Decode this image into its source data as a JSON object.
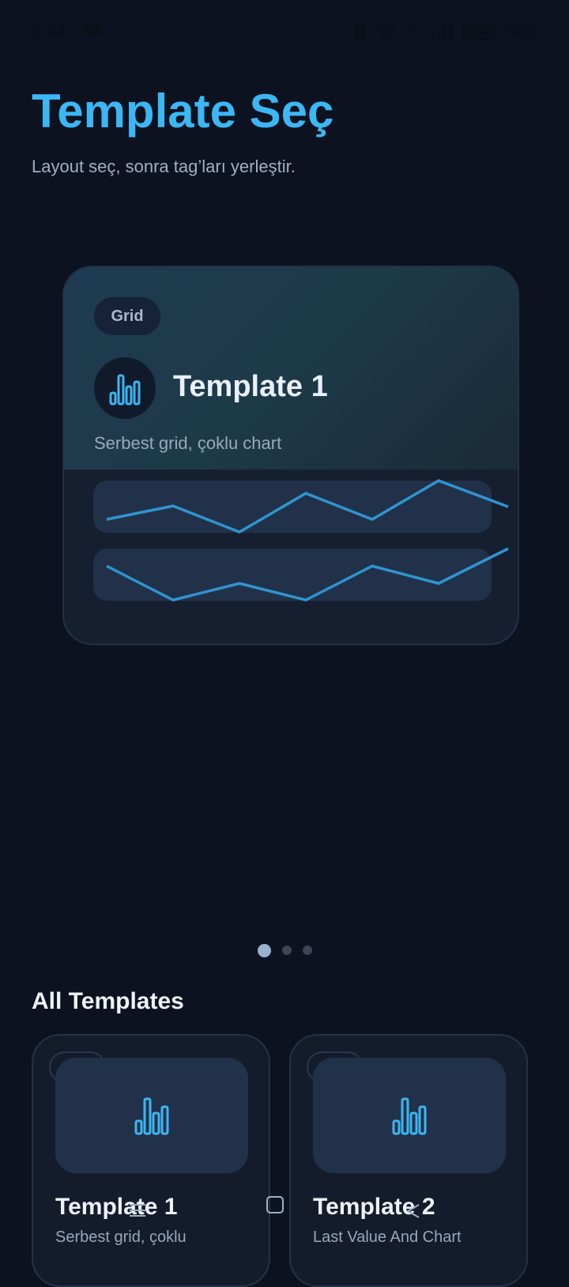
{
  "status_bar": {
    "time": "9:44",
    "battery_text": "%89",
    "icons": [
      "cloud-icon",
      "vibrate-icon",
      "wifi-icon",
      "volte-icon",
      "signal-icon",
      "battery-icon"
    ]
  },
  "header": {
    "title": "Template Seç",
    "subtitle": "Layout seç, sonra tag’ları yerleştir."
  },
  "featured": {
    "tag": "Grid",
    "name": "Template 1",
    "description": "Serbest grid, çoklu chart",
    "icon": "bar-chart-icon"
  },
  "carousel": {
    "pages": 3,
    "active_index": 0
  },
  "all_templates": {
    "title": "All Templates",
    "items": [
      {
        "name": "Template 1",
        "description": "Serbest grid, çoklu",
        "icon": "bar-chart-icon"
      },
      {
        "name": "Template 2",
        "description": "Last Value And Chart",
        "icon": "bar-chart-icon"
      }
    ]
  },
  "colors": {
    "background": "#0c1220",
    "accent": "#3bb7f3",
    "card": "#161f30",
    "chart_line": "#2f95cf"
  }
}
